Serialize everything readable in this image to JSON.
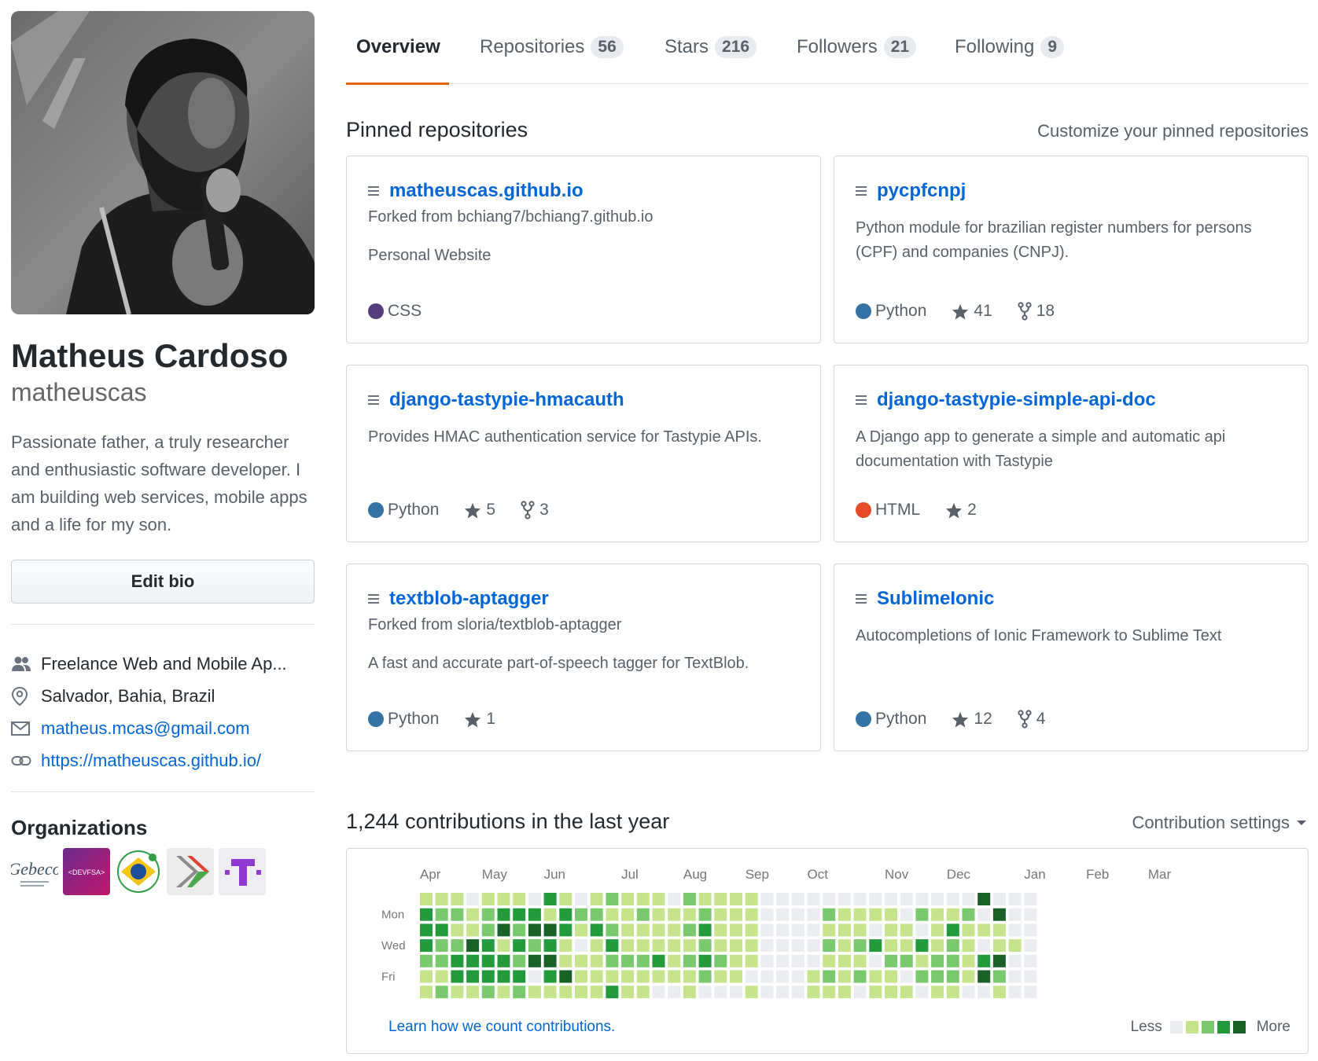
{
  "profile": {
    "fullname": "Matheus Cardoso",
    "login": "matheuscas",
    "bio": "Passionate father, a truly researcher and enthusiastic software developer. I am building web services, mobile apps and a life for my son.",
    "edit_bio_label": "Edit bio",
    "company": "Freelance Web and Mobile Ap...",
    "location": "Salvador, Bahia, Brazil",
    "email": "matheus.mcas@gmail.com",
    "website": "https://matheuscas.github.io/",
    "organizations_title": "Organizations",
    "organizations": [
      {
        "name": "Gebeco",
        "icon": "gebeco-logo"
      },
      {
        "name": "<DEVFSA>",
        "icon": "devfsa-logo"
      },
      {
        "name": "Brazil",
        "icon": "brazil-flag-logo"
      },
      {
        "name": "GDG Feira de Santana",
        "icon": "gdg-logo"
      },
      {
        "name": "T",
        "icon": "t-logo"
      }
    ]
  },
  "tabs": [
    {
      "label": "Overview",
      "count": null,
      "selected": true
    },
    {
      "label": "Repositories",
      "count": "56"
    },
    {
      "label": "Stars",
      "count": "216"
    },
    {
      "label": "Followers",
      "count": "21"
    },
    {
      "label": "Following",
      "count": "9"
    }
  ],
  "pinned": {
    "title": "Pinned repositories",
    "customize_label": "Customize your pinned repositories",
    "repos": [
      {
        "name": "matheuscas.github.io",
        "fork": "Forked from bchiang7/bchiang7.github.io",
        "description": "Personal Website",
        "language": "CSS",
        "lang_color": "#563d7c",
        "stars": null,
        "forks": null
      },
      {
        "name": "pycpfcnpj",
        "fork": null,
        "description": "Python module for brazilian register numbers for persons (CPF) and companies (CNPJ).",
        "language": "Python",
        "lang_color": "#3572A5",
        "stars": "41",
        "forks": "18"
      },
      {
        "name": "django-tastypie-hmacauth",
        "fork": null,
        "description": "Provides HMAC authentication service for Tastypie APIs.",
        "language": "Python",
        "lang_color": "#3572A5",
        "stars": "5",
        "forks": "3"
      },
      {
        "name": "django-tastypie-simple-api-doc",
        "fork": null,
        "description": "A Django app to generate a simple and automatic api documentation with Tastypie",
        "language": "HTML",
        "lang_color": "#e34c26",
        "stars": "2",
        "forks": null
      },
      {
        "name": "textblob-aptagger",
        "fork": "Forked from sloria/textblob-aptagger",
        "description": "A fast and accurate part-of-speech tagger for TextBlob.",
        "language": "Python",
        "lang_color": "#3572A5",
        "stars": "1",
        "forks": null
      },
      {
        "name": "SublimeIonic",
        "fork": null,
        "description": "Autocompletions of Ionic Framework to Sublime Text",
        "language": "Python",
        "lang_color": "#3572A5",
        "stars": "12",
        "forks": "4"
      }
    ]
  },
  "contributions": {
    "title": "1,244 contributions in the last year",
    "settings_label": "Contribution settings",
    "months": [
      "Apr",
      "May",
      "Jun",
      "Jul",
      "Aug",
      "Sep",
      "Oct",
      "Nov",
      "Dec",
      "Jan",
      "Feb",
      "Mar"
    ],
    "month_weeks": [
      0,
      4,
      8,
      13,
      17,
      21,
      25,
      30,
      34,
      39,
      43,
      47
    ],
    "day_labels": [
      "Mon",
      "Wed",
      "Fri"
    ],
    "learn_label": "Learn how we count contributions.",
    "less_label": "Less",
    "more_label": "More",
    "colors": [
      "#ebedf0",
      "#c6e48b",
      "#7bc96f",
      "#239a3b",
      "#196127"
    ],
    "weeks": [
      [
        1,
        3,
        3,
        3,
        2,
        1,
        1
      ],
      [
        1,
        2,
        3,
        2,
        2,
        1,
        2
      ],
      [
        1,
        2,
        1,
        2,
        3,
        3,
        1
      ],
      [
        0,
        1,
        1,
        4,
        3,
        3,
        1
      ],
      [
        1,
        2,
        2,
        3,
        3,
        3,
        2
      ],
      [
        1,
        3,
        4,
        1,
        3,
        3,
        1
      ],
      [
        1,
        3,
        2,
        3,
        2,
        3,
        2
      ],
      [
        0,
        3,
        4,
        2,
        4,
        0,
        1
      ],
      [
        3,
        1,
        4,
        3,
        4,
        3,
        1
      ],
      [
        1,
        3,
        3,
        1,
        1,
        4,
        1
      ],
      [
        0,
        2,
        1,
        0,
        1,
        1,
        1
      ],
      [
        1,
        2,
        3,
        1,
        1,
        1,
        1
      ],
      [
        2,
        1,
        2,
        3,
        2,
        1,
        3
      ],
      [
        1,
        1,
        1,
        1,
        2,
        1,
        1
      ],
      [
        1,
        2,
        1,
        1,
        2,
        1,
        1
      ],
      [
        1,
        1,
        1,
        1,
        3,
        1,
        0
      ],
      [
        0,
        1,
        1,
        1,
        1,
        1,
        0
      ],
      [
        2,
        1,
        2,
        1,
        2,
        1,
        1
      ],
      [
        1,
        2,
        3,
        2,
        3,
        2,
        0
      ],
      [
        1,
        1,
        1,
        1,
        2,
        1,
        0
      ],
      [
        1,
        1,
        1,
        1,
        1,
        1,
        0
      ],
      [
        1,
        1,
        1,
        1,
        1,
        0,
        1
      ],
      [
        0,
        0,
        0,
        0,
        0,
        0,
        0
      ],
      [
        0,
        0,
        0,
        0,
        0,
        0,
        0
      ],
      [
        0,
        0,
        0,
        0,
        0,
        0,
        0
      ],
      [
        0,
        0,
        0,
        0,
        0,
        1,
        1
      ],
      [
        0,
        2,
        1,
        2,
        1,
        2,
        1
      ],
      [
        0,
        1,
        1,
        1,
        1,
        1,
        1
      ],
      [
        0,
        1,
        1,
        2,
        1,
        2,
        0
      ],
      [
        0,
        1,
        0,
        3,
        0,
        1,
        1
      ],
      [
        0,
        1,
        1,
        1,
        2,
        1,
        1
      ],
      [
        0,
        0,
        1,
        1,
        2,
        0,
        1
      ],
      [
        0,
        2,
        0,
        3,
        1,
        2,
        0
      ],
      [
        0,
        1,
        1,
        1,
        2,
        2,
        1
      ],
      [
        0,
        1,
        3,
        2,
        2,
        2,
        1
      ],
      [
        0,
        2,
        1,
        1,
        1,
        1,
        0
      ],
      [
        4,
        0,
        1,
        0,
        3,
        4,
        0
      ],
      [
        0,
        4,
        1,
        1,
        4,
        2,
        1
      ],
      [
        0,
        0,
        0,
        1,
        0,
        0,
        0
      ],
      [
        0,
        0,
        0,
        0,
        0,
        0,
        0
      ]
    ]
  }
}
